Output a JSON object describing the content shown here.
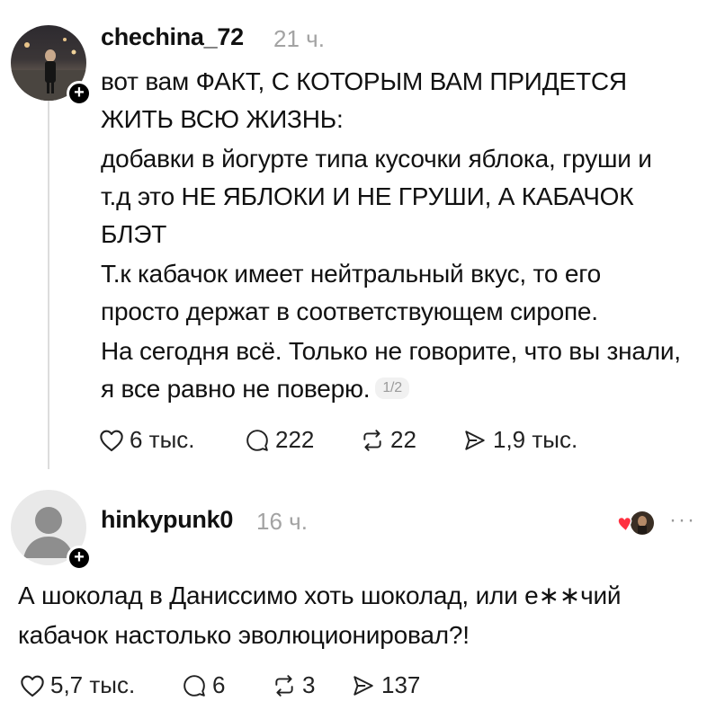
{
  "post1": {
    "username": "chechina_72",
    "time": "21 ч.",
    "paragraphs": [
      "вот вам ФАКТ, С КОТОРЫМ ВАМ ПРИДЕТСЯ ЖИТЬ ВСЮ ЖИЗНЬ:",
      "добавки в йогурте типа кусочки яблока, груши и т.д это НЕ ЯБЛОКИ И НЕ ГРУШИ, А КАБАЧОК БЛЭТ",
      "Т.к кабачок имеет нейтральный вкус, то его просто держат в соответствующем сиропе.",
      "На сегодня всё. Только не говорите, что вы знали, я все равно не поверю."
    ],
    "page_counter": "1/2",
    "likes": "6 тыс.",
    "comments": "222",
    "reposts": "22",
    "shares": "1,9 тыс."
  },
  "post2": {
    "username": "hinkypunk0",
    "time": "16 ч.",
    "text": "А шоколад в Даниссимо хоть шоколад, или е∗∗чий кабачок настолько эволюционировал?!",
    "likes": "5,7 тыс.",
    "comments": "6",
    "reposts": "3",
    "shares": "137",
    "more": "···"
  },
  "colors": {
    "text": "#111111",
    "muted": "#a3a3a3",
    "heart": "#ff3040",
    "thread_line": "#dcdcdc"
  },
  "icons": [
    "heart-icon",
    "comment-icon",
    "repost-icon",
    "share-icon",
    "plus-icon",
    "more-icon"
  ]
}
